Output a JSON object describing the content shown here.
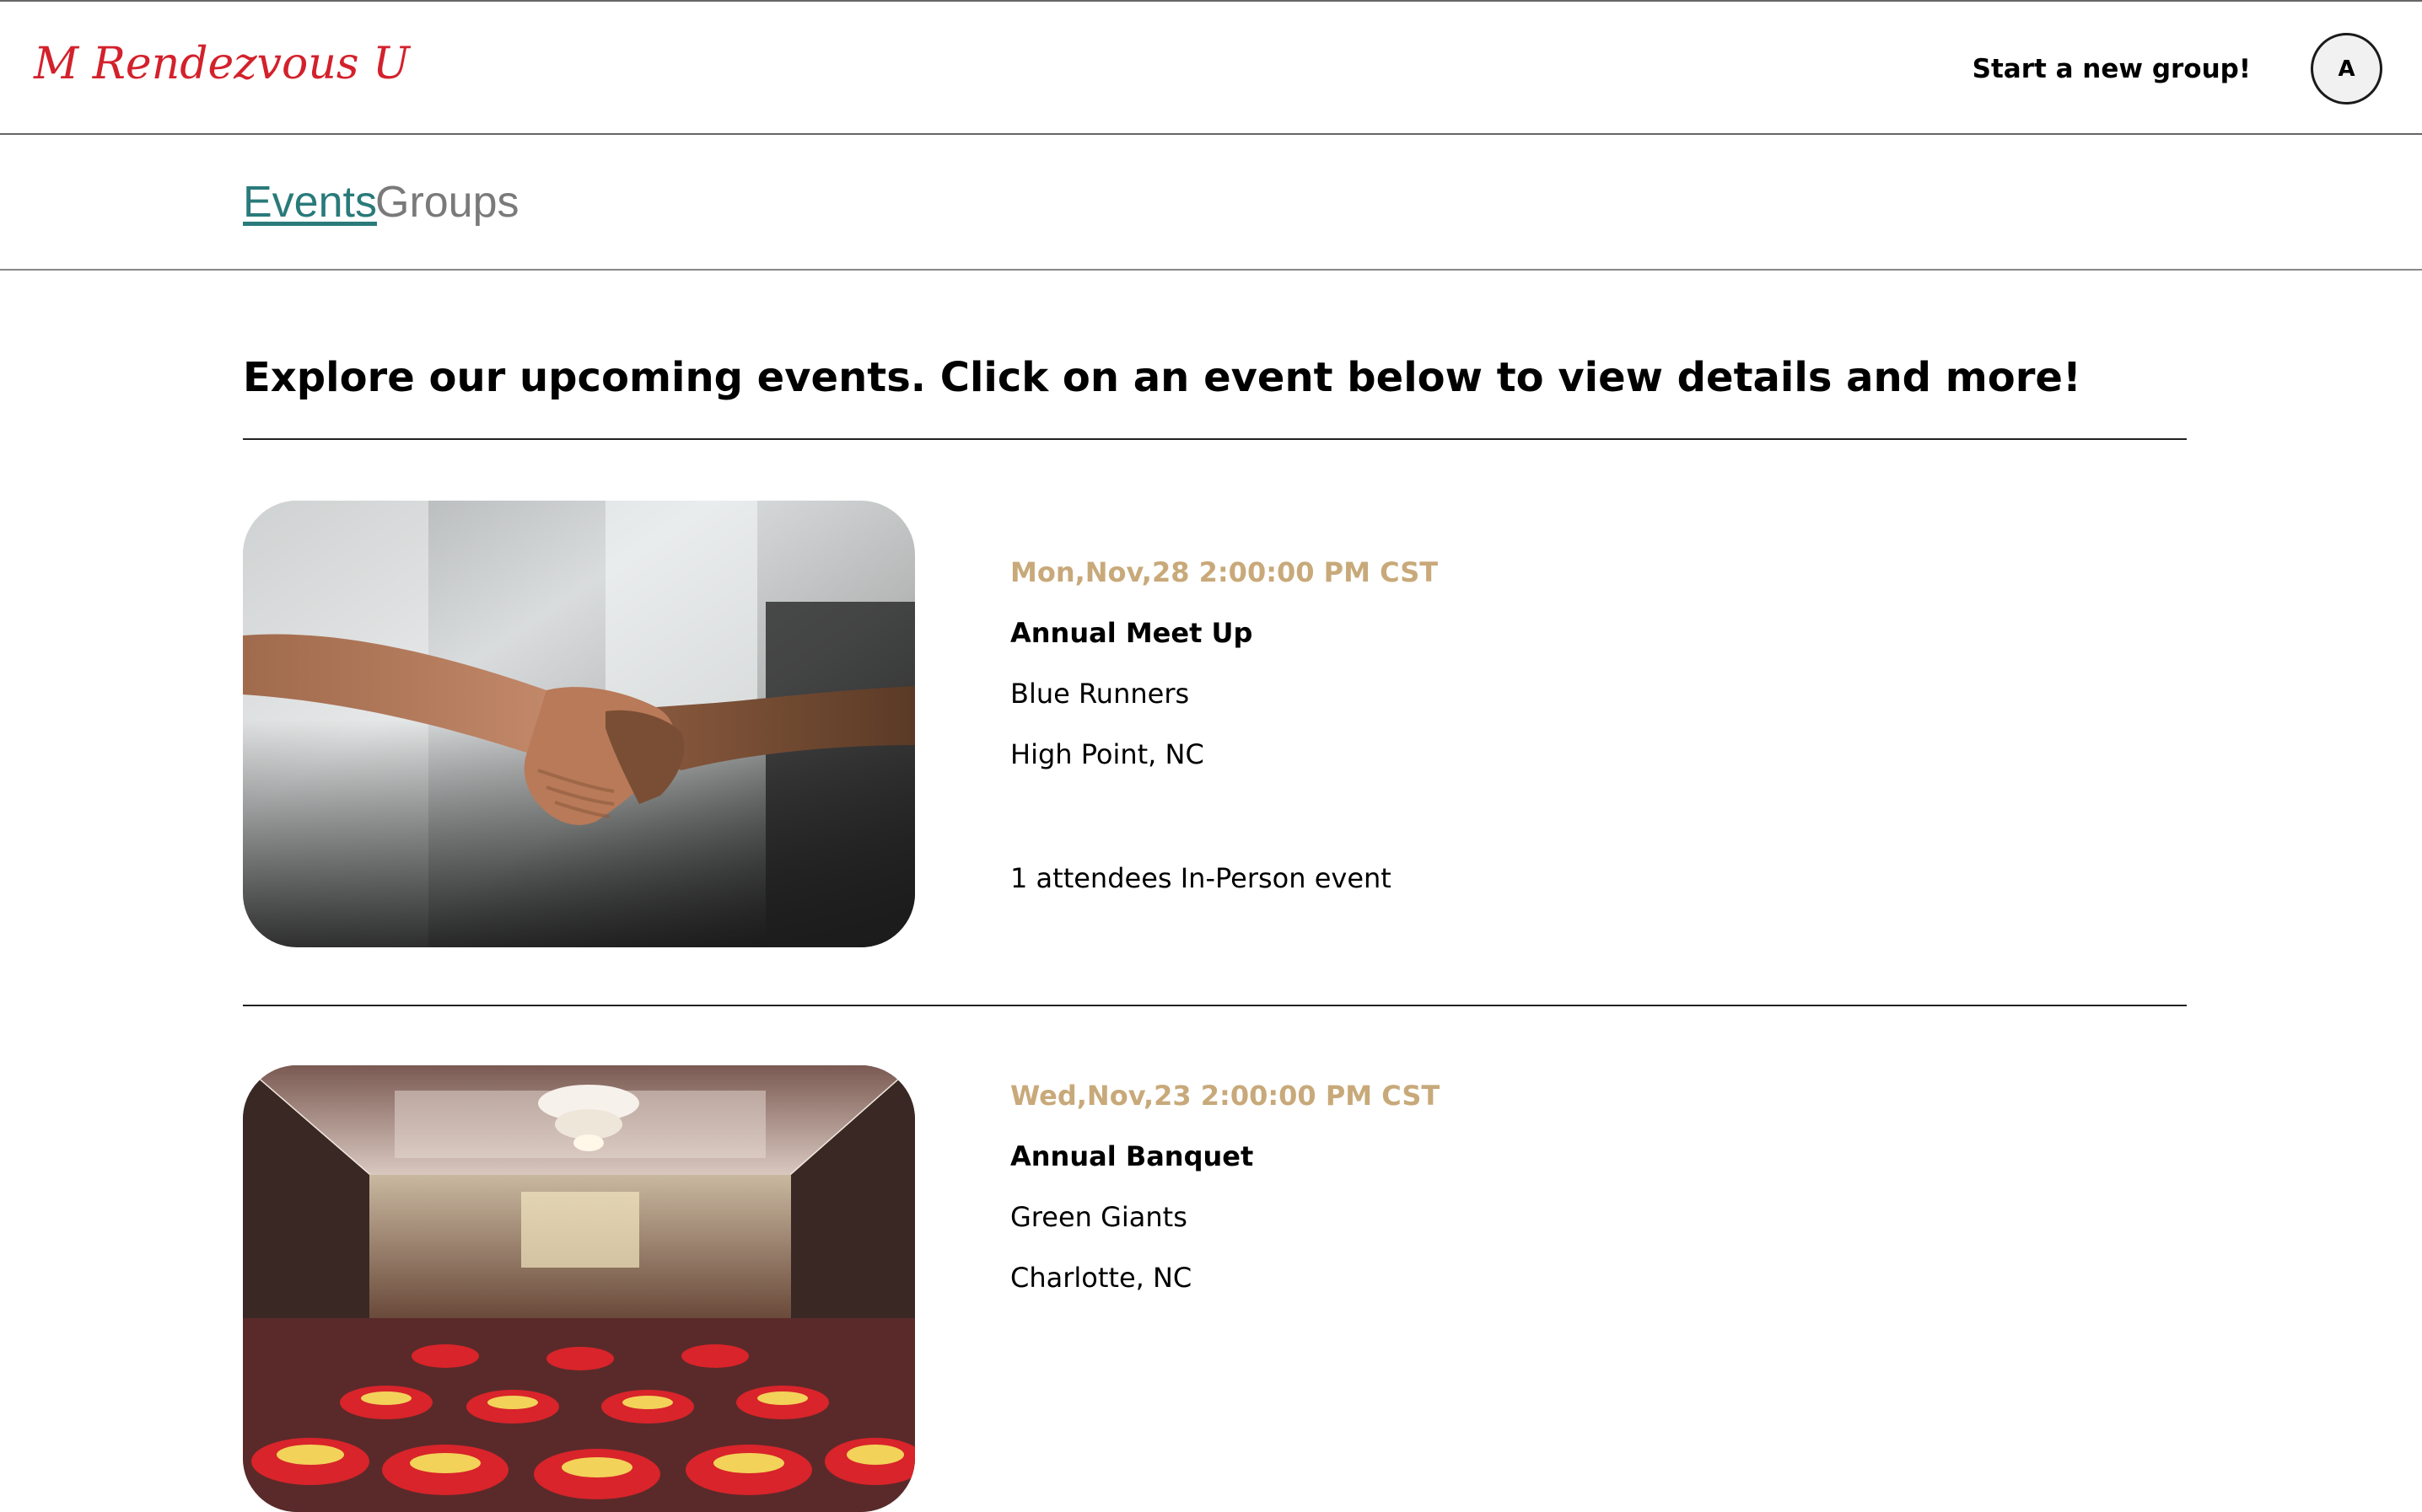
{
  "header": {
    "logo_text": "M Rendezvous U",
    "new_group_label": "Start a new group!",
    "avatar_initial": "A"
  },
  "tabs": {
    "events": "Events",
    "groups": "Groups"
  },
  "main": {
    "headline": "Explore our upcoming events. Click on an event below to view details and more!"
  },
  "events": [
    {
      "date": "Mon,Nov,28 2:00:00 PM CST",
      "title": "Annual Meet Up",
      "group": "Blue Runners",
      "location": "High Point, NC",
      "attendees_text": "1 attendees In-Person event",
      "image": "handshake-photo"
    },
    {
      "date": "Wed,Nov,23 2:00:00 PM CST",
      "title": "Annual Banquet",
      "group": "Green Giants",
      "location": "Charlotte, NC",
      "image": "banquet-hall-photo"
    }
  ],
  "colors": {
    "logo": "#d3212c",
    "active_tab": "#2a7a7a",
    "inactive_tab": "#7a7a7a",
    "event_date": "#c8a97a"
  }
}
